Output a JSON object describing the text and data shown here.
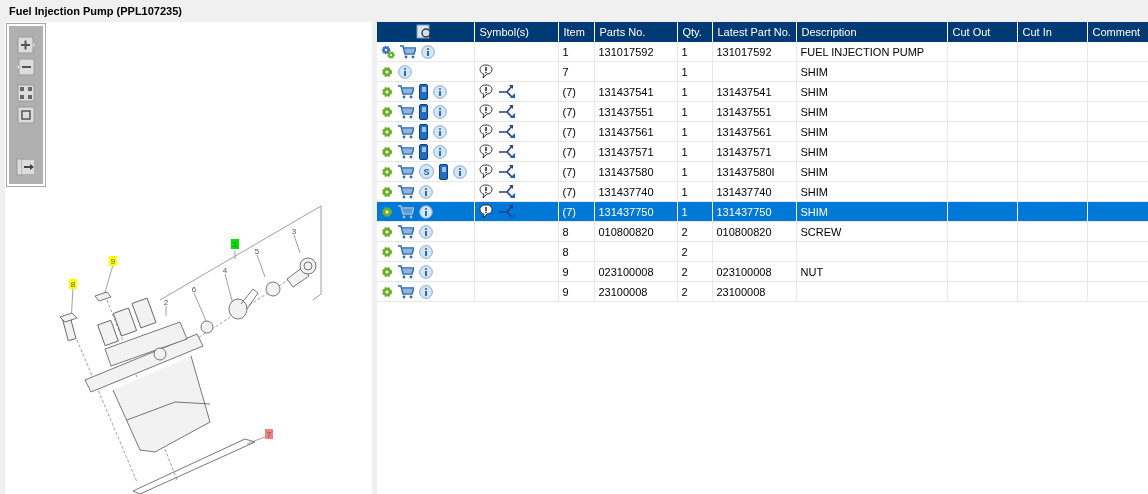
{
  "title": "Fuel Injection Pump (PPL107235)",
  "diagram": {
    "callouts": [
      {
        "label": "1",
        "color": "#00e000"
      },
      {
        "label": "3"
      },
      {
        "label": "5"
      },
      {
        "label": "4"
      },
      {
        "label": "9",
        "color": "#ffff00"
      },
      {
        "label": "6"
      },
      {
        "label": "2"
      },
      {
        "label": "8",
        "color": "#ffff00"
      },
      {
        "label": "7",
        "color": "#f08080"
      }
    ]
  },
  "table": {
    "columns": [
      "Symbol(s)",
      "Item",
      "Parts No.",
      "Qty.",
      "Latest Part No.",
      "Description",
      "Cut Out",
      "Cut In",
      "Comment"
    ],
    "rows": [
      {
        "selected": false,
        "icons": [
          {
            "kind": "gears"
          },
          {
            "kind": "cart"
          },
          {
            "kind": "info"
          }
        ],
        "symbols": [],
        "item": "1",
        "part": "131017592",
        "qty": "1",
        "latest": "131017592",
        "description": "FUEL INJECTION PUMP"
      },
      {
        "selected": false,
        "icons": [
          {
            "kind": "gear"
          },
          {
            "kind": "info"
          }
        ],
        "symbols": [
          {
            "kind": "note"
          }
        ],
        "item": "7",
        "part": "",
        "qty": "1",
        "latest": "",
        "description": "SHIM"
      },
      {
        "selected": false,
        "icons": [
          {
            "kind": "gear"
          },
          {
            "kind": "cart"
          },
          {
            "kind": "book"
          },
          {
            "kind": "info"
          }
        ],
        "symbols": [
          {
            "kind": "note"
          },
          {
            "kind": "branch"
          }
        ],
        "item": "(7)",
        "part": "131437541",
        "qty": "1",
        "latest": "131437541",
        "description": "SHIM"
      },
      {
        "selected": false,
        "icons": [
          {
            "kind": "gear"
          },
          {
            "kind": "cart"
          },
          {
            "kind": "book"
          },
          {
            "kind": "info"
          }
        ],
        "symbols": [
          {
            "kind": "note"
          },
          {
            "kind": "branch"
          }
        ],
        "item": "(7)",
        "part": "131437551",
        "qty": "1",
        "latest": "131437551",
        "description": "SHIM"
      },
      {
        "selected": false,
        "icons": [
          {
            "kind": "gear"
          },
          {
            "kind": "cart"
          },
          {
            "kind": "book"
          },
          {
            "kind": "info"
          }
        ],
        "symbols": [
          {
            "kind": "note"
          },
          {
            "kind": "branch"
          }
        ],
        "item": "(7)",
        "part": "131437561",
        "qty": "1",
        "latest": "131437561",
        "description": "SHIM"
      },
      {
        "selected": false,
        "icons": [
          {
            "kind": "gear"
          },
          {
            "kind": "cart"
          },
          {
            "kind": "book"
          },
          {
            "kind": "info"
          }
        ],
        "symbols": [
          {
            "kind": "note"
          },
          {
            "kind": "branch"
          }
        ],
        "item": "(7)",
        "part": "131437571",
        "qty": "1",
        "latest": "131437571",
        "description": "SHIM"
      },
      {
        "selected": false,
        "icons": [
          {
            "kind": "gear"
          },
          {
            "kind": "cart"
          },
          {
            "kind": "s",
            "label": "S"
          },
          {
            "kind": "book"
          },
          {
            "kind": "info"
          }
        ],
        "symbols": [
          {
            "kind": "note"
          },
          {
            "kind": "branch"
          }
        ],
        "item": "(7)",
        "part": "131437580",
        "qty": "1",
        "latest": "131437580I",
        "description": "SHIM"
      },
      {
        "selected": false,
        "icons": [
          {
            "kind": "gear"
          },
          {
            "kind": "cart"
          },
          {
            "kind": "info"
          }
        ],
        "symbols": [
          {
            "kind": "note"
          },
          {
            "kind": "branch"
          }
        ],
        "item": "(7)",
        "part": "131437740",
        "qty": "1",
        "latest": "131437740",
        "description": "SHIM"
      },
      {
        "selected": true,
        "icons": [
          {
            "kind": "gear"
          },
          {
            "kind": "cart"
          },
          {
            "kind": "info"
          }
        ],
        "symbols": [
          {
            "kind": "note"
          },
          {
            "kind": "branch"
          }
        ],
        "item": "(7)",
        "part": "131437750",
        "qty": "1",
        "latest": "131437750",
        "description": "SHIM"
      },
      {
        "selected": false,
        "icons": [
          {
            "kind": "gear"
          },
          {
            "kind": "cart"
          },
          {
            "kind": "info"
          }
        ],
        "symbols": [],
        "item": "8",
        "part": "010800820",
        "qty": "2",
        "latest": "010800820",
        "description": "SCREW"
      },
      {
        "selected": false,
        "icons": [
          {
            "kind": "gear"
          },
          {
            "kind": "cart"
          },
          {
            "kind": "info"
          }
        ],
        "symbols": [],
        "item": "8",
        "part": "",
        "qty": "2",
        "latest": "",
        "description": ""
      },
      {
        "selected": false,
        "icons": [
          {
            "kind": "gear"
          },
          {
            "kind": "cart"
          },
          {
            "kind": "info"
          }
        ],
        "symbols": [],
        "item": "9",
        "part": "023100008",
        "qty": "2",
        "latest": "023100008",
        "description": "NUT"
      },
      {
        "selected": false,
        "icons": [
          {
            "kind": "gear"
          },
          {
            "kind": "cart"
          },
          {
            "kind": "info"
          }
        ],
        "symbols": [],
        "item": "9",
        "part": "23100008",
        "qty": "2",
        "latest": "23100008",
        "description": ""
      }
    ]
  }
}
